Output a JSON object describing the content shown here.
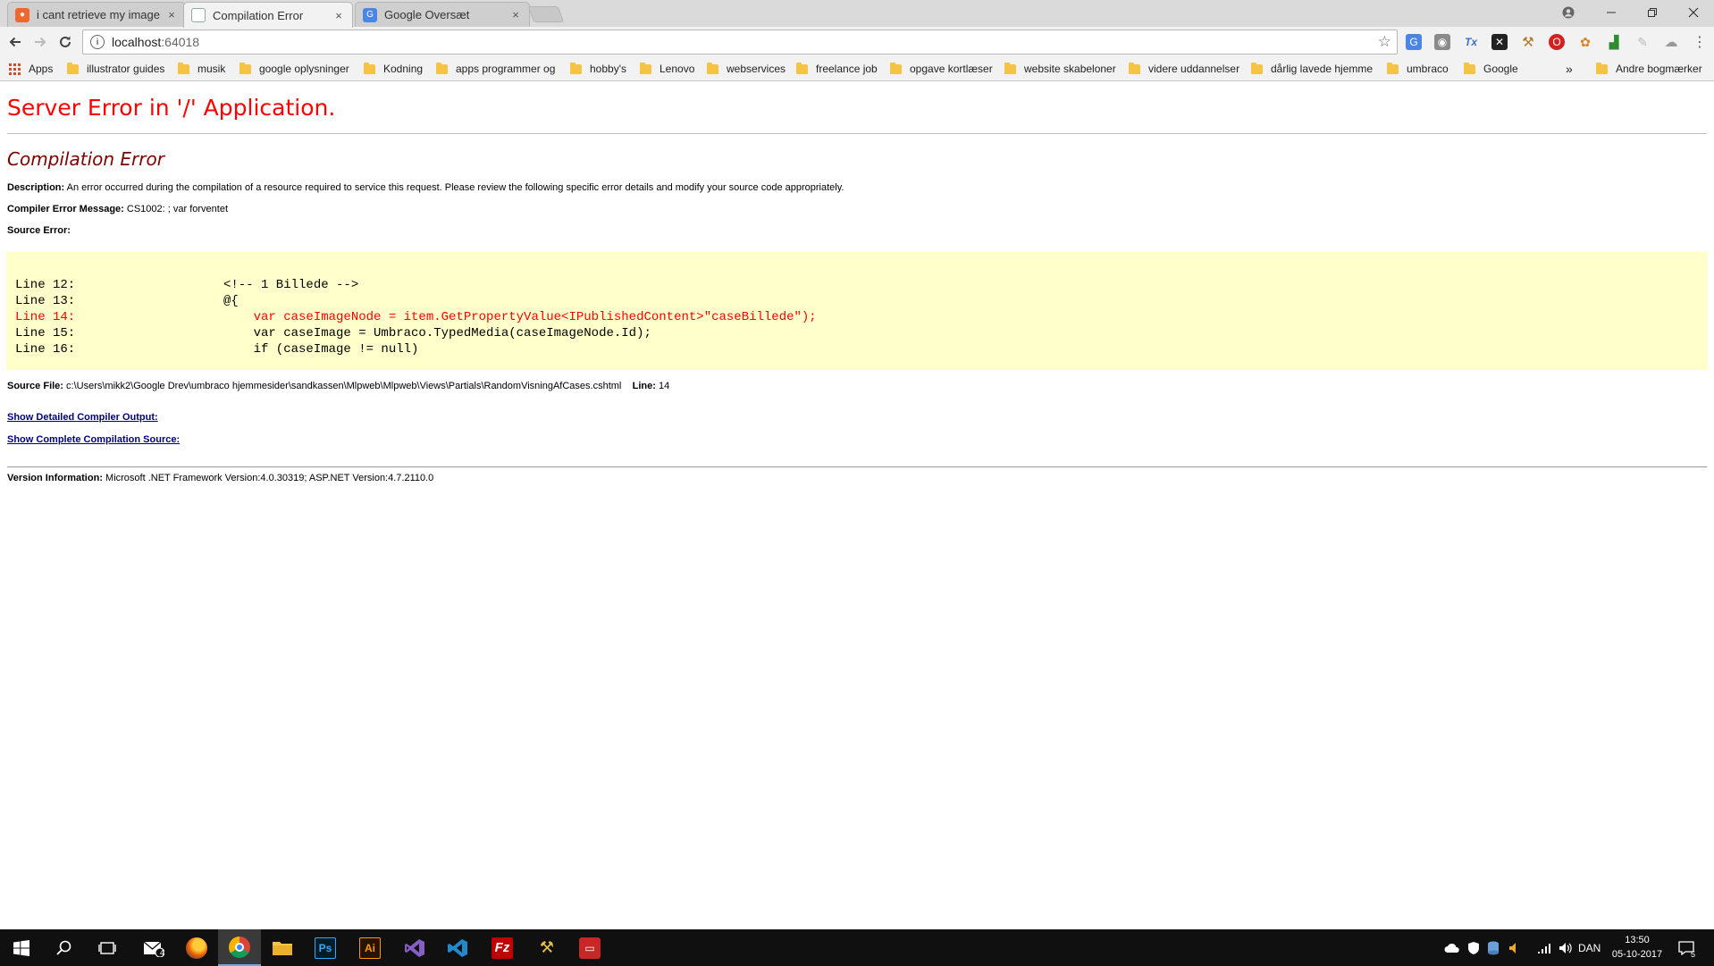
{
  "browser": {
    "tabs": [
      {
        "title": "i cant retrieve my images",
        "icon": "umbraco-favicon-icon"
      },
      {
        "title": "Compilation Error",
        "icon": "page-icon"
      },
      {
        "title": "Google Oversæt",
        "icon": "google-translate-icon"
      }
    ],
    "tab_close_glyph": "×",
    "address": {
      "host": "localhost",
      "port": ":64018"
    },
    "bookmarks": [
      "Apps",
      "illustrator guides",
      "musik",
      "google oplysninger",
      "Kodning",
      "apps programmer og",
      "hobby's",
      "Lenovo",
      "webservices",
      "freelance job",
      "opgave kortlæser",
      "website skabeloner",
      "videre uddannelser",
      "dårlig lavede hjemme",
      "umbraco",
      "Google"
    ],
    "bookmarks_overflow": "»",
    "other_bookmarks": "Andre bogmærker"
  },
  "page": {
    "title": "Server Error in '/' Application.",
    "subtitle": "Compilation Error",
    "description_label": "Description:",
    "description_text": " An error occurred during the compilation of a resource required to service this request. Please review the following specific error details and modify your source code appropriately.",
    "compiler_label": "Compiler Error Message:",
    "compiler_text": " CS1002: ; var forventet",
    "source_error_label": "Source Error:",
    "code_lines": [
      {
        "num": "Line 12:",
        "code": "<!-- 1 Billede -->",
        "error": false
      },
      {
        "num": "Line 13:",
        "code": "@{",
        "error": false
      },
      {
        "num": "Line 14:",
        "code": "    var caseImageNode = item.GetPropertyValue<IPublishedContent>\"caseBillede\");",
        "error": true
      },
      {
        "num": "Line 15:",
        "code": "    var caseImage = Umbraco.TypedMedia(caseImageNode.Id);",
        "error": false
      },
      {
        "num": "Line 16:",
        "code": "    if (caseImage != null)",
        "error": false
      }
    ],
    "source_file_label": "Source File:",
    "source_file_path": " c:\\Users\\mikk2\\Google Drev\\umbraco hjemmesider\\sandkassen\\Mlpweb\\Mlpweb\\Views\\Partials\\RandomVisningAfCases.cshtml",
    "line_label": "Line:",
    "line_value": " 14",
    "link_compiler_output": "Show Detailed Compiler Output:",
    "link_compilation_source": "Show Complete Compilation Source:",
    "version_label": "Version Information:",
    "version_text": " Microsoft .NET Framework Version:4.0.30319; ASP.NET Version:4.7.2110.0"
  },
  "taskbar": {
    "apps": [
      "windows-start-icon",
      "search-icon",
      "task-view-icon",
      "mail-icon",
      "firefox-icon",
      "chrome-icon",
      "file-explorer-icon",
      "photoshop-icon",
      "illustrator-icon",
      "visual-studio-icon",
      "vscode-icon",
      "filezilla-icon",
      "tools-icon",
      "app-icon"
    ],
    "mail_badge": "4",
    "ps_label": "Ps",
    "ai_label": "Ai",
    "language": "DAN",
    "time": "13:50",
    "date": "05-10-2017",
    "notification_count": "5"
  },
  "colors": {
    "error_red": "#ff0000",
    "subtitle_maroon": "#800000",
    "code_background": "#ffffcc",
    "link_navy": "#000080"
  }
}
